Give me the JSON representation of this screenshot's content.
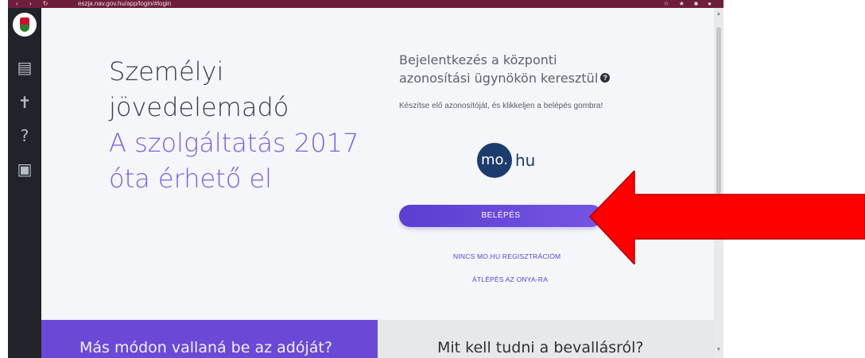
{
  "browser": {
    "nav_glyphs": "‹ › ↻",
    "url": "eszja.nav.gov.hu/app/login/#login",
    "ext_glyphs": "☆ ★ ■ ●"
  },
  "sidebar": {
    "logo": "hungarian-coat-of-arms-icon",
    "icons": [
      {
        "name": "tax-form-icon",
        "glyph": "▤"
      },
      {
        "name": "accessibility-icon",
        "glyph": "✝"
      },
      {
        "name": "help-icon",
        "glyph": "?"
      },
      {
        "name": "document-icon",
        "glyph": "▣"
      }
    ]
  },
  "hero": {
    "line1": "Személyi",
    "line2": "jövedelemadó",
    "line3": "A szolgáltatás 2017",
    "line4": "óta érhető el"
  },
  "login": {
    "title_line1": "Bejelentkezés a központi",
    "title_line2": "azonosítási ügynökön keresztül",
    "help": "?",
    "subtitle": "Készítse elő azonosítóját, és klikkeljen a belépés gombra!",
    "provider_circle": "mo.",
    "provider_text": "hu",
    "button_label": "BELÉPÉS",
    "link_register": "NINCS MO.HU REGISZTRÁCIÓM",
    "link_onya": "ÁTLÉPÉS AZ ONYA-RA"
  },
  "panels": {
    "left_title": "Más módon vallaná be az adóját?",
    "right_title": "Mit kell tudni a bevallásról?"
  },
  "colors": {
    "accent_purple": "#6a49d6",
    "heading_purple": "#7b5fe0",
    "browser_bar": "#6e1e3d",
    "arrow_red": "#ff0000",
    "mohu_blue": "#1d3c6e"
  }
}
